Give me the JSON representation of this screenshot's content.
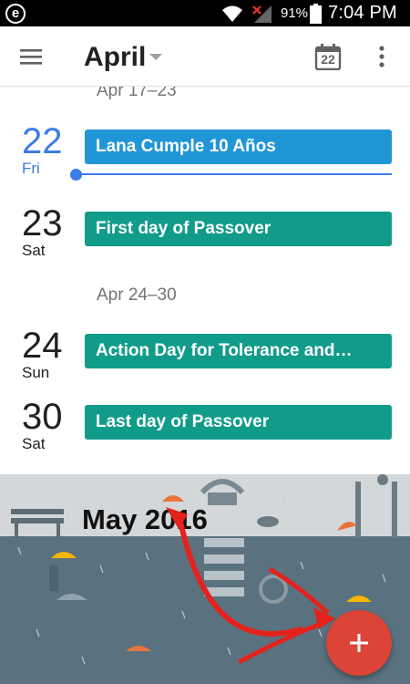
{
  "status_bar": {
    "left_icon": "e",
    "battery": "91%",
    "time": "7:04 PM",
    "icons": [
      "wifi-icon",
      "signal-icon",
      "battery-icon"
    ]
  },
  "app_bar": {
    "month": "April",
    "today_day": "22",
    "icons": [
      "menu-icon",
      "dropdown-caret-icon",
      "today-calendar-icon",
      "overflow-menu-icon"
    ]
  },
  "schedule": {
    "weeks": [
      {
        "label": "Apr 17–23",
        "days": [
          {
            "num": "22",
            "name": "Fri",
            "today": true,
            "events": [
              {
                "title": "Lana Cumple 10 Años",
                "color": "#2196d6"
              }
            ]
          },
          {
            "num": "23",
            "name": "Sat",
            "today": false,
            "events": [
              {
                "title": "First day of Passover",
                "color": "#119c8a"
              }
            ]
          }
        ]
      },
      {
        "label": "Apr 24–30",
        "days": [
          {
            "num": "24",
            "name": "Sun",
            "today": false,
            "events": [
              {
                "title": "Action Day for Tolerance and…",
                "color": "#119c8a"
              }
            ]
          },
          {
            "num": "30",
            "name": "Sat",
            "today": false,
            "events": [
              {
                "title": "Last day of Passover",
                "color": "#119c8a"
              }
            ]
          }
        ]
      }
    ]
  },
  "banner": {
    "title": "May 2016"
  },
  "fab": {
    "label": "+",
    "color": "#db4437"
  },
  "colors": {
    "accent_blue": "#3d7ce6",
    "event_blue": "#2196d6",
    "event_teal": "#119c8a",
    "annotation_red": "#e3231b"
  }
}
